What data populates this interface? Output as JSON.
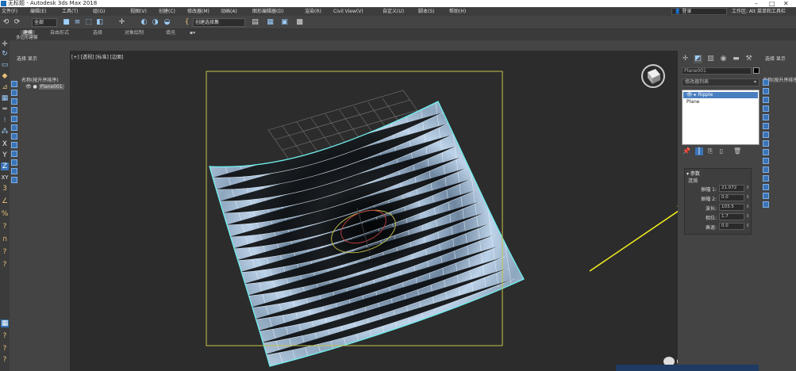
{
  "window": {
    "title": "无标题 - Autodesk 3ds Max 2018",
    "controls": [
      "–",
      "□",
      "✕"
    ]
  },
  "menu": {
    "items": [
      "文件(F)",
      "编辑(E)",
      "工具(T)",
      "组(G)",
      "视图(V)",
      "创建(C)",
      "修改器(M)",
      "动画(A)",
      "图形编辑器(D)",
      "渲染(R)",
      "Civil View(V)",
      "自定义(U)",
      "脚本(S)",
      "帮助(H)"
    ],
    "login": "登录",
    "workspace": "工作区: Alt 菜单和工具栏"
  },
  "toolbar": {
    "selection_filter": "全部",
    "selection_set": "创建选择集"
  },
  "ribbon": {
    "tabs": [
      "建模",
      "自由形式",
      "选择",
      "对象绘制",
      "填充"
    ],
    "subtitle": "多边形建模"
  },
  "scene_explorer": {
    "tabs": "选择  显示",
    "column_header": "名称(按升序排序)",
    "rows": [
      "Plane001"
    ]
  },
  "viewport": {
    "label": "[+] [透视] [标准] [边面]"
  },
  "command_panel": {
    "object_name": "Plane001",
    "modifier_list": "修改器列表",
    "stack": [
      "Ripple",
      "Plane"
    ],
    "rollout_title": "参数",
    "rollout_group": "涟漪",
    "params": [
      {
        "label": "振幅 1:",
        "value": "21.072"
      },
      {
        "label": "振幅 2:",
        "value": "0.0"
      },
      {
        "label": "波长:",
        "value": "103.5"
      },
      {
        "label": "相位:",
        "value": "1.7"
      },
      {
        "label": "衰退:",
        "value": "0.0"
      }
    ]
  },
  "right_panel": {
    "tabs": "选择  显示",
    "column_header": "名称(按升序排序)"
  },
  "colors": {
    "mesh_fill": "#a9c4de",
    "mesh_edge": "#6ff0ee",
    "selection_box": "#c7c34a",
    "annotation_arrow": "#f4f01e",
    "accent_blue": "#3a74b7"
  }
}
